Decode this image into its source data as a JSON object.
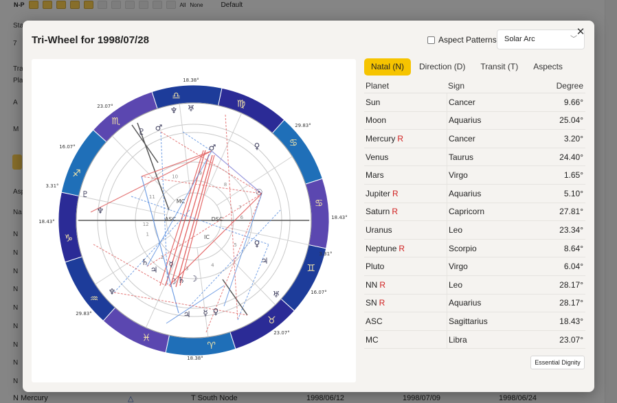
{
  "background": {
    "side_labels": [
      "N-P",
      "Sta",
      "7",
      "Tra",
      "Plac",
      "A",
      "M",
      "Asp",
      "Na",
      "N",
      "N",
      "N",
      "N",
      "N",
      "N",
      "N",
      "N",
      "N"
    ],
    "toolbar_labels": [
      "All",
      "None",
      "Default"
    ],
    "bottom_row": {
      "cell1": "N Mercury",
      "cell2": "T South Node",
      "cell3": "1998/06/12",
      "cell4": "1998/07/09",
      "cell5": "1998/06/24"
    }
  },
  "dialog": {
    "title": "Tri-Wheel for 1998/07/28",
    "aspect_patterns_label": "Aspect Patterns",
    "direction_select": "Solar Arc",
    "close_glyph": "✕",
    "essential_dignity_label": "Essential Dignity"
  },
  "tabs": [
    {
      "label": "Natal (N)",
      "active": true
    },
    {
      "label": "Direction (D)",
      "active": false
    },
    {
      "label": "Transit (T)",
      "active": false
    },
    {
      "label": "Aspects",
      "active": false
    }
  ],
  "table": {
    "headers": {
      "planet": "Planet",
      "sign": "Sign",
      "degree": "Degree"
    },
    "rows": [
      {
        "planet": "Sun",
        "retro": "",
        "sign": "Cancer",
        "degree": "9.66°"
      },
      {
        "planet": "Moon",
        "retro": "",
        "sign": "Aquarius",
        "degree": "25.04°"
      },
      {
        "planet": "Mercury",
        "retro": "R",
        "sign": "Cancer",
        "degree": "3.20°"
      },
      {
        "planet": "Venus",
        "retro": "",
        "sign": "Taurus",
        "degree": "24.40°"
      },
      {
        "planet": "Mars",
        "retro": "",
        "sign": "Virgo",
        "degree": "1.65°"
      },
      {
        "planet": "Jupiter",
        "retro": "R",
        "sign": "Aquarius",
        "degree": "5.10°"
      },
      {
        "planet": "Saturn",
        "retro": "R",
        "sign": "Capricorn",
        "degree": "27.81°"
      },
      {
        "planet": "Uranus",
        "retro": "",
        "sign": "Leo",
        "degree": "23.34°"
      },
      {
        "planet": "Neptune",
        "retro": "R",
        "sign": "Scorpio",
        "degree": "8.64°"
      },
      {
        "planet": "Pluto",
        "retro": "",
        "sign": "Virgo",
        "degree": "6.04°"
      },
      {
        "planet": "NN",
        "retro": "R",
        "sign": "Leo",
        "degree": "28.17°"
      },
      {
        "planet": "SN",
        "retro": "R",
        "sign": "Aquarius",
        "degree": "28.17°"
      },
      {
        "planet": "ASC",
        "retro": "",
        "sign": "Sagittarius",
        "degree": "18.43°"
      },
      {
        "planet": "MC",
        "retro": "",
        "sign": "Libra",
        "degree": "23.07°"
      }
    ]
  },
  "wheel": {
    "center_labels": {
      "mc": "MC",
      "asc": "ASC",
      "dsc": "DSC",
      "ic": "IC"
    },
    "cusp_labels": [
      "18.38°",
      "29.83°",
      "18.43°",
      "3.31°",
      "16.07°",
      "23.07°",
      "18.38°",
      "29.83°",
      "18.43°",
      "3.31°",
      "16.07°",
      "23.07°"
    ],
    "signs": [
      {
        "glyph": "♍",
        "name": "virgo"
      },
      {
        "glyph": "♋",
        "name": "cancer"
      },
      {
        "glyph": "♋",
        "name": "cancer"
      },
      {
        "glyph": "♊",
        "name": "gemini"
      },
      {
        "glyph": "♉",
        "name": "taurus"
      },
      {
        "glyph": "♈",
        "name": "aries"
      },
      {
        "glyph": "♓",
        "name": "pisces"
      },
      {
        "glyph": "♒",
        "name": "aquarius"
      },
      {
        "glyph": "♑",
        "name": "capricorn"
      },
      {
        "glyph": "♐",
        "name": "sagittarius"
      },
      {
        "glyph": "♏",
        "name": "scorpio"
      },
      {
        "glyph": "♎",
        "name": "libra"
      }
    ],
    "house_numbers": [
      "1",
      "2",
      "3",
      "4",
      "5",
      "6",
      "7",
      "8",
      "9",
      "10",
      "11",
      "12"
    ],
    "planets": [
      {
        "glyph": "♂",
        "name": "mars"
      },
      {
        "glyph": "♆",
        "name": "neptune"
      },
      {
        "glyph": "♅",
        "name": "uranus"
      },
      {
        "glyph": "♇",
        "name": "pluto"
      },
      {
        "glyph": "♂",
        "name": "mars"
      },
      {
        "glyph": "♀",
        "name": "venus"
      },
      {
        "glyph": "☉",
        "name": "sun"
      },
      {
        "glyph": "♀",
        "name": "venus"
      },
      {
        "glyph": "♃",
        "name": "jupiter"
      },
      {
        "glyph": "☽",
        "name": "moon"
      },
      {
        "glyph": "♄",
        "name": "saturn"
      },
      {
        "glyph": "☿",
        "name": "mercury"
      },
      {
        "glyph": "♇",
        "name": "pluto"
      },
      {
        "glyph": "♆",
        "name": "neptune"
      },
      {
        "glyph": "♄",
        "name": "saturn"
      },
      {
        "glyph": "♃",
        "name": "jupiter"
      },
      {
        "glyph": "☽",
        "name": "moon"
      },
      {
        "glyph": "♃",
        "name": "jupiter"
      },
      {
        "glyph": "♆",
        "name": "neptune"
      },
      {
        "glyph": "☿",
        "name": "mercury"
      },
      {
        "glyph": "♀",
        "name": "venus"
      },
      {
        "glyph": "♅",
        "name": "uranus"
      }
    ]
  }
}
